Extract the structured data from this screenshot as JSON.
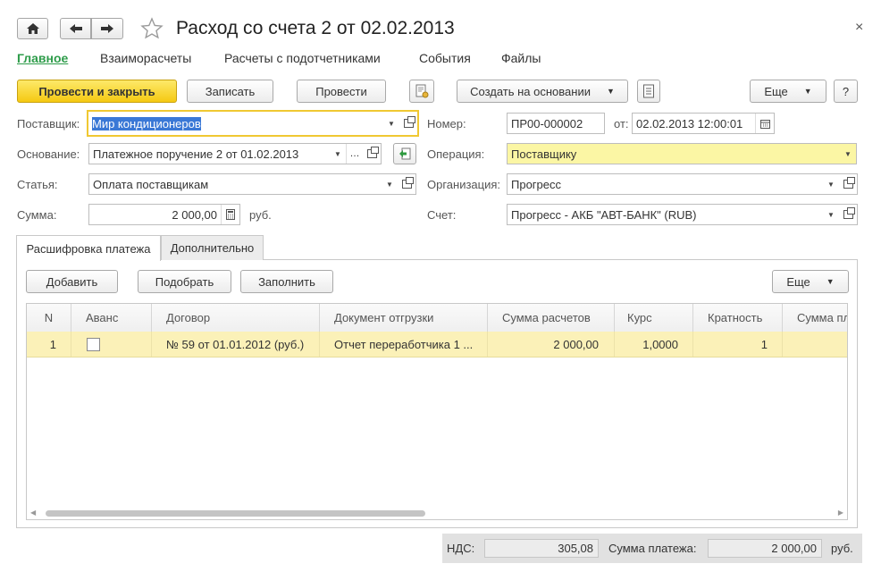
{
  "window": {
    "title": "Расход со счета 2 от 02.02.2013",
    "close_glyph": "×"
  },
  "icons": {
    "home": "home-icon",
    "back": "arrow-left-icon",
    "forward": "arrow-right-icon",
    "star": "star-icon",
    "close": "close-icon"
  },
  "sections": [
    "Главное",
    "Взаиморасчеты",
    "Расчеты с подотчетниками",
    "События",
    "Файлы"
  ],
  "toolbar": {
    "post_close": "Провести и закрыть",
    "save": "Записать",
    "post": "Провести",
    "create_based": "Создать на основании",
    "more": "Еще",
    "help": "?"
  },
  "form": {
    "supplier_label": "Поставщик:",
    "supplier_value": "Мир кондиционеров",
    "basis_label": "Основание:",
    "basis_value": "Платежное поручение 2 от 01.02.2013",
    "article_label": "Статья:",
    "article_value": "Оплата поставщикам",
    "sum_label": "Сумма:",
    "sum_value": "2 000,00",
    "sum_currency": "руб.",
    "number_label": "Номер:",
    "number_value": "ПР00-000002",
    "date_label": "от:",
    "date_value": "02.02.2013 12:00:01",
    "operation_label": "Операция:",
    "operation_value": "Поставщику",
    "org_label": "Организация:",
    "org_value": "Прогресс",
    "account_label": "Счет:",
    "account_value": "Прогресс - АКБ \"АВТ-БАНК\" (RUB)"
  },
  "tabs": [
    "Расшифровка платежа",
    "Дополнительно"
  ],
  "table_toolbar": {
    "add": "Добавить",
    "pick": "Подобрать",
    "fill": "Заполнить",
    "more": "Еще"
  },
  "table": {
    "columns": [
      "N",
      "Аванс",
      "Договор",
      "Документ отгрузки",
      "Сумма расчетов",
      "Курс",
      "Кратность",
      "Сумма пл"
    ],
    "rows": [
      {
        "n": "1",
        "advance": false,
        "contract": "№ 59 от 01.01.2012 (руб.)",
        "shipment": "Отчет переработчика 1 ...",
        "settle_sum": "2 000,00",
        "rate": "1,0000",
        "multiplicity": "1",
        "pay_sum": ""
      }
    ]
  },
  "footer": {
    "vat_label": "НДС:",
    "vat_value": "305,08",
    "pay_label": "Сумма платежа:",
    "pay_value": "2 000,00",
    "currency": "руб."
  }
}
